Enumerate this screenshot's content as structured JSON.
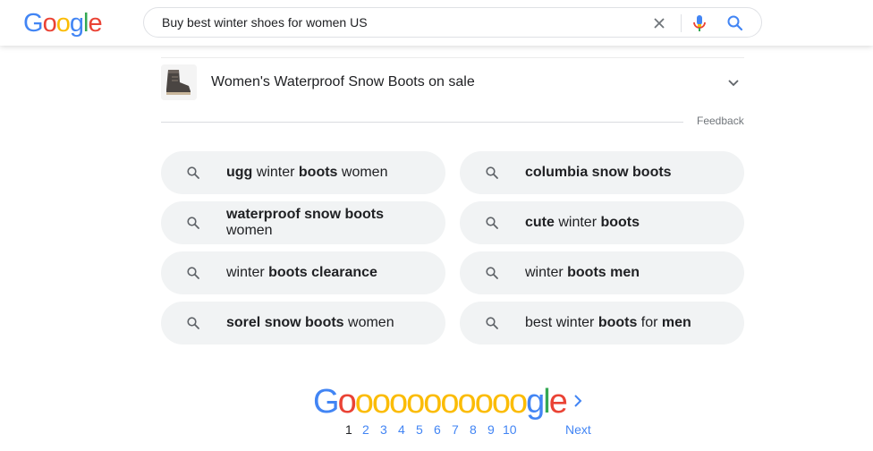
{
  "search": {
    "query": "Buy best winter shoes for women US"
  },
  "result": {
    "title": "Women's Waterproof Snow Boots on sale",
    "feedback_label": "Feedback"
  },
  "related": [
    {
      "parts": [
        {
          "t": "ugg",
          "b": true
        },
        {
          "t": " winter ",
          "b": false
        },
        {
          "t": "boots",
          "b": true
        },
        {
          "t": " women",
          "b": false
        }
      ]
    },
    {
      "parts": [
        {
          "t": "columbia snow boots",
          "b": true
        }
      ]
    },
    {
      "parts": [
        {
          "t": "waterproof snow boots",
          "b": true
        },
        {
          "t": " women",
          "b": false
        }
      ]
    },
    {
      "parts": [
        {
          "t": "cute",
          "b": true
        },
        {
          "t": " winter ",
          "b": false
        },
        {
          "t": "boots",
          "b": true
        }
      ]
    },
    {
      "parts": [
        {
          "t": "winter ",
          "b": false
        },
        {
          "t": "boots clearance",
          "b": true
        }
      ]
    },
    {
      "parts": [
        {
          "t": "winter ",
          "b": false
        },
        {
          "t": "boots men",
          "b": true
        }
      ]
    },
    {
      "parts": [
        {
          "t": "sorel snow boots",
          "b": true
        },
        {
          "t": " women",
          "b": false
        }
      ]
    },
    {
      "parts": [
        {
          "t": "best winter ",
          "b": false
        },
        {
          "t": "boots",
          "b": true
        },
        {
          "t": " for ",
          "b": false
        },
        {
          "t": "men",
          "b": true
        }
      ]
    }
  ],
  "pagination": {
    "pages": [
      "1",
      "2",
      "3",
      "4",
      "5",
      "6",
      "7",
      "8",
      "9",
      "10"
    ],
    "current": "1",
    "next_label": "Next"
  },
  "colors": {
    "blue": "#4285f4",
    "red": "#ea4335",
    "yellow": "#fbbc05",
    "green": "#34a853"
  }
}
